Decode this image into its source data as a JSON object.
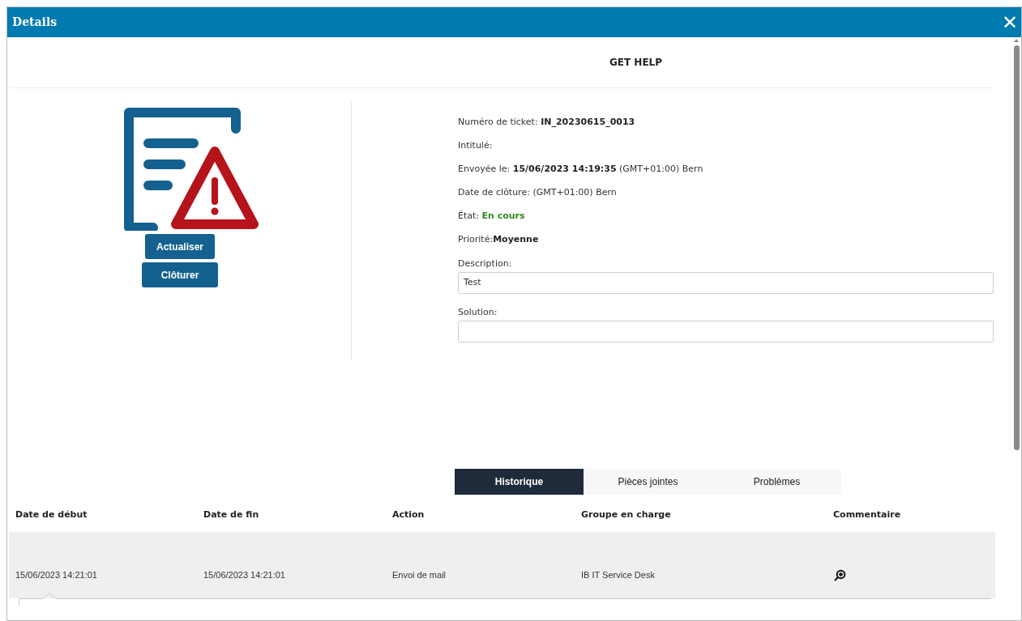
{
  "window": {
    "title": "Details",
    "close": "✕"
  },
  "heading": "GET HELP",
  "buttons": [
    "Actualiser",
    "Clôturer"
  ],
  "fields": [
    {
      "kind": "plain",
      "label": "Numéro de ticket: ",
      "value": "IN_20230615_0013"
    },
    {
      "kind": "plain",
      "label": "Intitulé:"
    },
    {
      "kind": "plain",
      "label": "Envoyée le: ",
      "value": "15/06/2023 14:19:35",
      "note": " (GMT+01:00) Bern"
    },
    {
      "kind": "plain",
      "label": "Date de clôture:",
      "note": " (GMT+01:00) Bern"
    },
    {
      "kind": "status",
      "label": "État: ",
      "value": "En cours"
    },
    {
      "kind": "plain",
      "label": "Priorité:",
      "value": "Moyenne"
    }
  ],
  "text_fields": [
    {
      "label": "Description:",
      "value": "Test"
    },
    {
      "label": "Solution:"
    }
  ],
  "tabs": [
    {
      "label": "Historique",
      "selected": true
    },
    {
      "label": "Pièces jointes",
      "selected": false
    },
    {
      "label": "Problèmes",
      "selected": false
    }
  ],
  "table": {
    "columns": [
      "Date de début",
      "Date de fin",
      "Action",
      "Groupe en charge",
      "Commentaire"
    ],
    "rows": [
      {
        "cells": [
          "15/06/2023 14:21:01",
          "15/06/2023 14:21:01",
          "Envoi de mail",
          "IB IT Service Desk"
        ]
      }
    ]
  }
}
